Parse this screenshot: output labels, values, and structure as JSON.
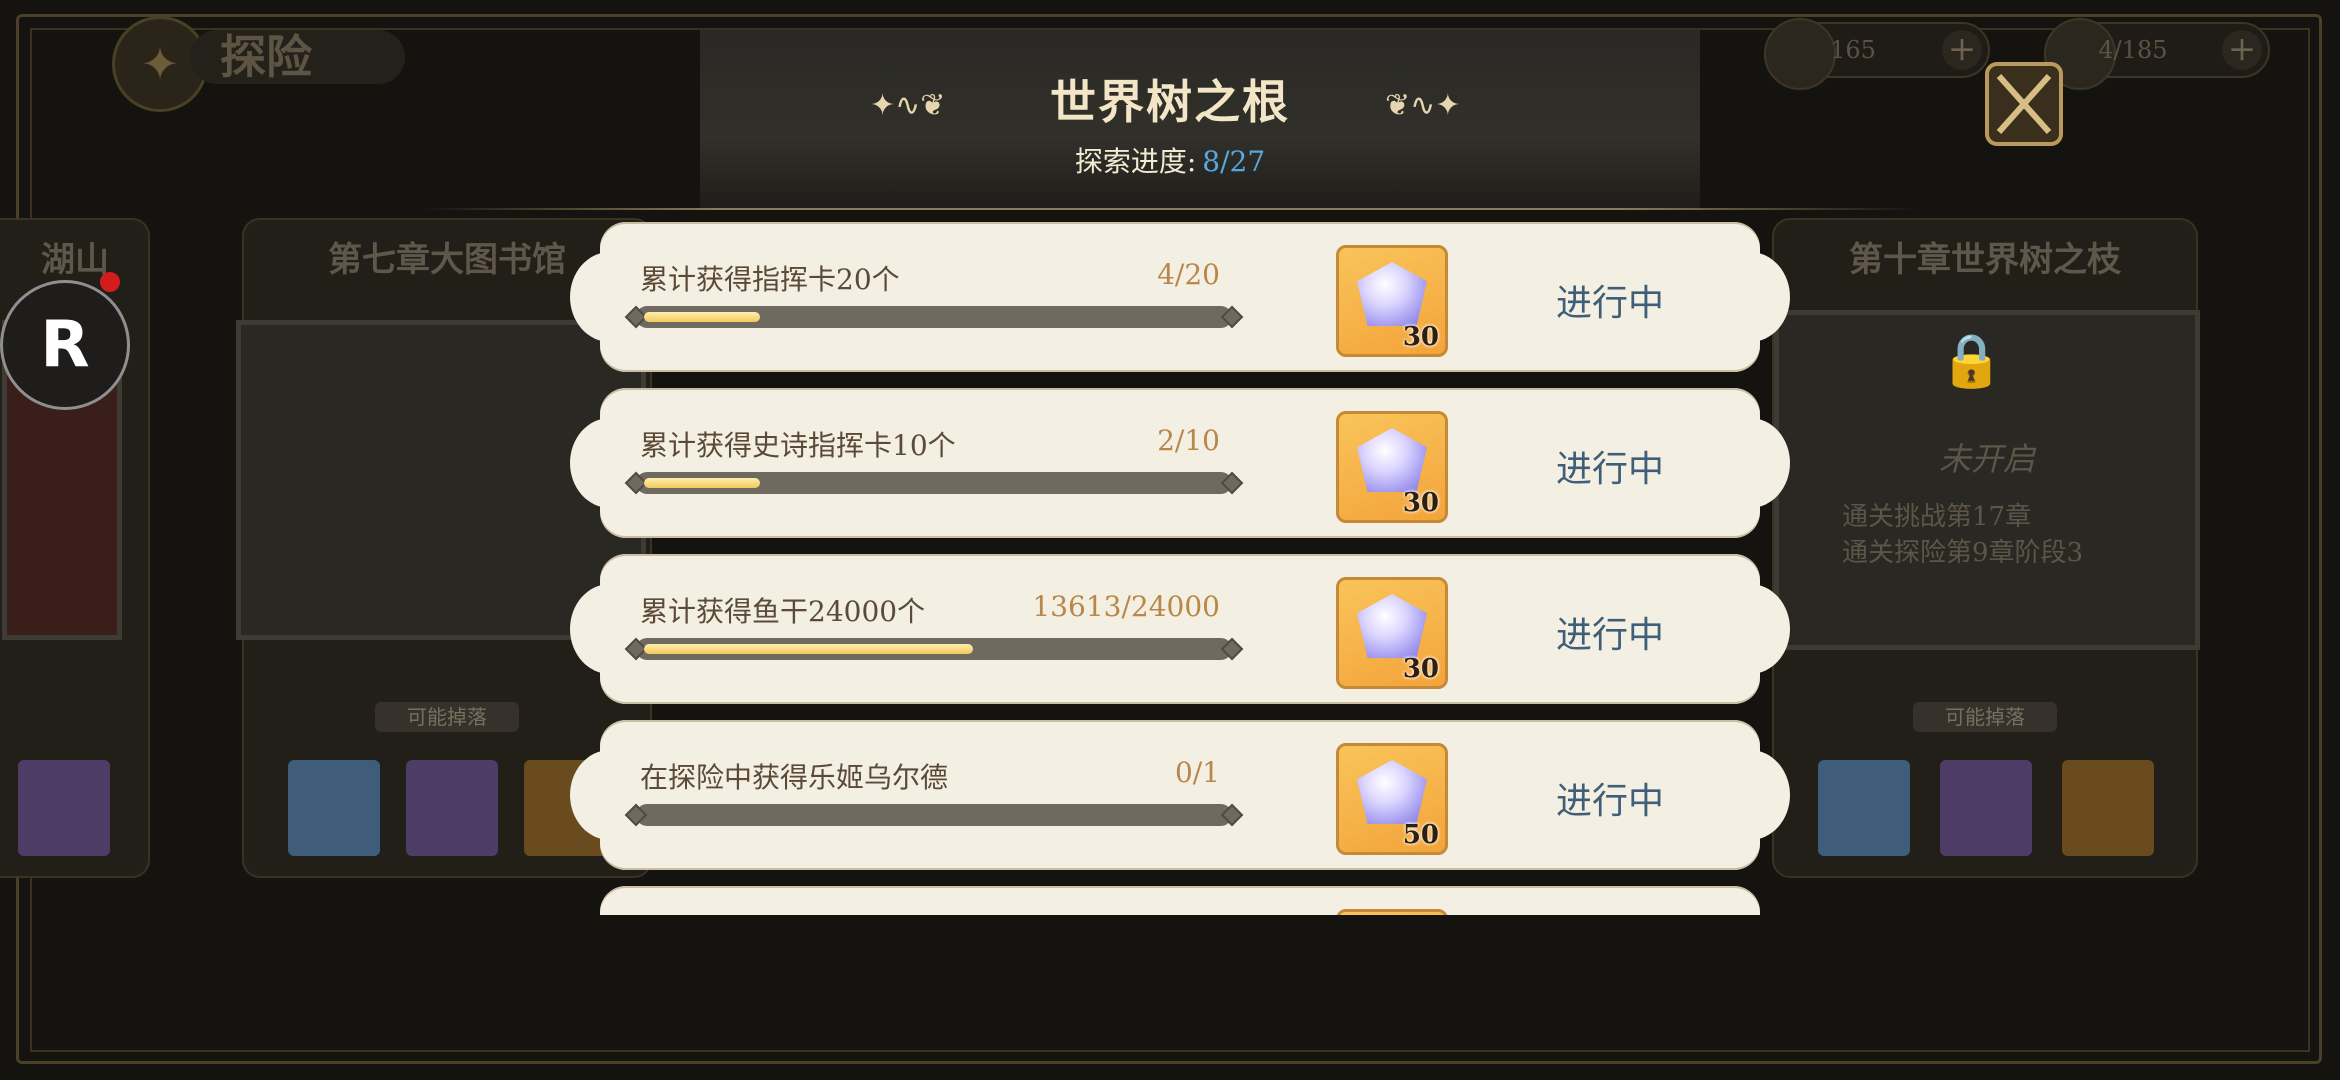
{
  "top_bar": {
    "page_title": "探险",
    "resource_1": {
      "value": "165",
      "plus": "+"
    },
    "resource_2": {
      "value": "4/185",
      "plus": "+"
    }
  },
  "background": {
    "left_edge_title": "湖山",
    "card_left": {
      "title": "第七章大图书馆",
      "drop_label": "可能掉落"
    },
    "card_right": {
      "title": "第十章世界树之枝",
      "locked_label": "未开启",
      "req_1": "通关挑战第17章",
      "req_2": "通关探险第9章阶段3",
      "drop_label": "可能掉落"
    },
    "float_button_letter": "R"
  },
  "dialog": {
    "title": "世界树之根",
    "progress_label": "探索进度:",
    "progress_value": "8/27",
    "tasks": [
      {
        "name": "累计获得指挥卡20个",
        "count": "4/20",
        "progress": 0.2,
        "reward_qty": "30",
        "status": "进行中"
      },
      {
        "name": "累计获得史诗指挥卡10个",
        "count": "2/10",
        "progress": 0.2,
        "reward_qty": "30",
        "status": "进行中"
      },
      {
        "name": "累计获得鱼干24000个",
        "count": "13613/24000",
        "progress": 0.567,
        "reward_qty": "30",
        "status": "进行中"
      },
      {
        "name": "在探险中获得乐姬乌尔德",
        "count": "0/1",
        "progress": 0.0,
        "reward_qty": "50",
        "status": "进行中"
      }
    ]
  }
}
